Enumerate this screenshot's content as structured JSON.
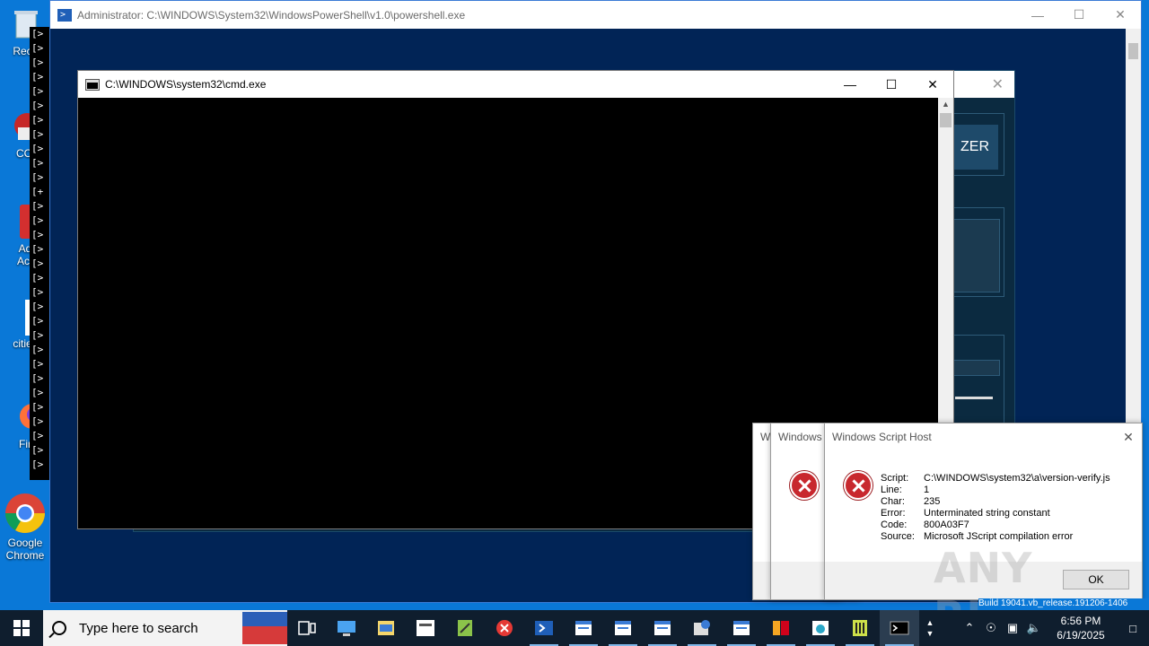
{
  "desktop": {
    "icons": [
      {
        "label": "Recy",
        "icon": "recycle-bin-icon"
      },
      {
        "label": "CCl",
        "icon": "ccleaner-icon"
      },
      {
        "label": "Ad\nAcr",
        "icon": "acrobat-icon"
      },
      {
        "label": "cities",
        "icon": "document-icon"
      },
      {
        "label": "Fir",
        "icon": "firefox-icon"
      },
      {
        "label": "Google\nChrome",
        "icon": "chrome-icon"
      }
    ]
  },
  "powershell": {
    "title": "Administrator: C:\\WINDOWS\\System32\\WindowsPowerShell\\v1.0\\powershell.exe",
    "console_lines": [
      "[>",
      "[>",
      "[>",
      "[>",
      "[>",
      "[>",
      "[>",
      "[>",
      "[>",
      "[>",
      "[>",
      "[+",
      "[>",
      "[>",
      "[>",
      "[>",
      "[>",
      "[>",
      "[>",
      "[>",
      "[>",
      "[>",
      "[>",
      "[>",
      "[>",
      "[>",
      "[>",
      "[>",
      "[>",
      "[>",
      "[>"
    ]
  },
  "background_app": {
    "button_text": "ZER"
  },
  "cmd": {
    "title": "C:\\WINDOWS\\system32\\cmd.exe"
  },
  "dialogs": {
    "back1_title": "Wi",
    "back2_title": "Windows",
    "main_title": "Windows Script Host",
    "fields": [
      {
        "key": "Script:",
        "value": "C:\\WINDOWS\\system32\\a\\version-verify.js"
      },
      {
        "key": "Line:",
        "value": "1"
      },
      {
        "key": "Char:",
        "value": "235"
      },
      {
        "key": "Error:",
        "value": "Unterminated string constant"
      },
      {
        "key": "Code:",
        "value": "800A03F7"
      },
      {
        "key": "Source:",
        "value": "Microsoft JScript compilation error"
      }
    ],
    "ok_label": "OK"
  },
  "watermark": "ANY RUN",
  "taskbar": {
    "search_placeholder": "Type here to search",
    "build_text": "Build 19041.vb_release.191206-1406",
    "time": "6:56 PM",
    "date": "6/19/2025"
  }
}
